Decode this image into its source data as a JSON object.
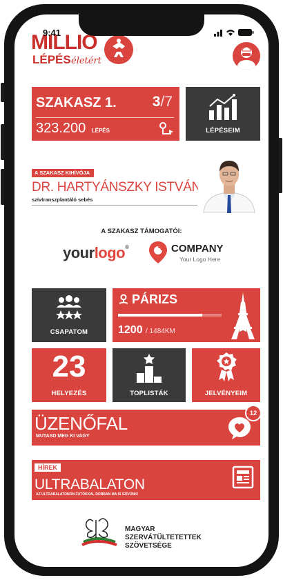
{
  "status_bar": {
    "time": "9:41"
  },
  "header": {
    "logo_line1": "MILLIÓ",
    "logo_line2": "LÉPÉS",
    "logo_script": "életért"
  },
  "stage": {
    "title": "SZAKASZ 1.",
    "current": "3",
    "total": "/7",
    "steps_value": "323.200",
    "steps_unit": "LÉPÉS"
  },
  "my_steps": {
    "label": "LÉPÉSEIM"
  },
  "challenger": {
    "badge": "A SZAKASZ KIHÍVÓJA",
    "name": "DR. HARTYÁNSZKY ISTVÁN",
    "role": "szívtranszplantáló sebés"
  },
  "sponsors": {
    "title": "A SZAKASZ TÁMOGATÓI:",
    "logo1_part1": "your",
    "logo1_part2": "logo",
    "logo1_reg": "®",
    "logo2_name": "COMPANY",
    "logo2_tagline": "Your Logo Here"
  },
  "team": {
    "label": "CSAPATOM"
  },
  "destination": {
    "city": "PÁRIZS",
    "current_km": "1200",
    "total_km": "/ 1484KM",
    "progress": 0.81
  },
  "rank": {
    "value": "23",
    "label": "HELYEZÉS"
  },
  "toplists": {
    "label": "TOPLISTÁK"
  },
  "badges": {
    "label": "JELVÉNYEIM"
  },
  "wall": {
    "title": "ÜZENŐFAL",
    "subtitle": "MUTASD MEG KI VAGY",
    "count": "12"
  },
  "news": {
    "tag": "HÍREK",
    "title": "ULTRABALATON",
    "subtitle": "AZ ULTRABALATONON FUTÓKKAL DOBBAN MA IS SZÍVÜNK!"
  },
  "footer": {
    "line1": "MAGYAR",
    "line2": "SZERVÁTÜLTETETTEK",
    "line3": "SZÖVETSÉGE"
  },
  "colors": {
    "accent": "#d9443f",
    "dark": "#3a3a3a",
    "frame": "#141414"
  }
}
